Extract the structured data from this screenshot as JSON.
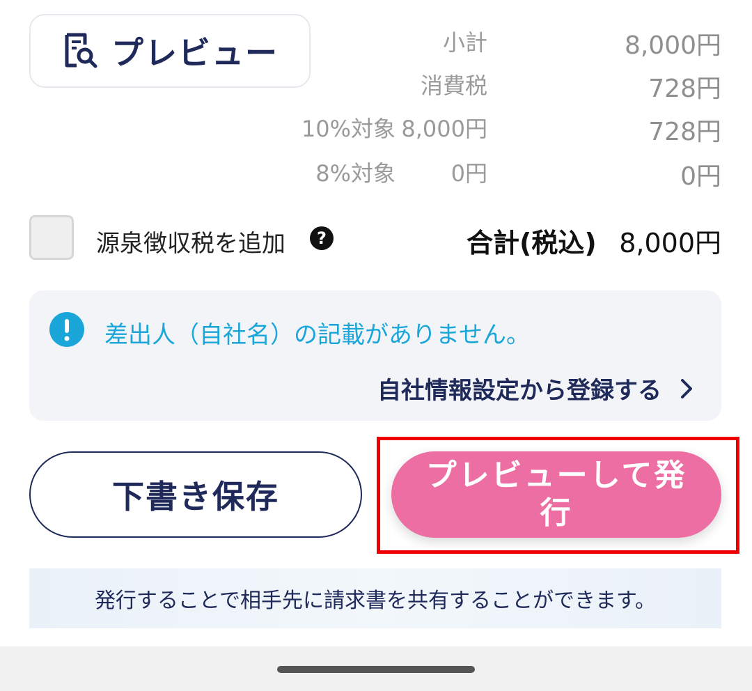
{
  "preview_button": {
    "label": "プレビュー",
    "icon": "document-search-icon"
  },
  "summary": {
    "subtotal": {
      "label": "小計",
      "value": "8,000円"
    },
    "tax": {
      "label": "消費税",
      "value": "728円"
    },
    "rate10": {
      "label": "10%対象",
      "base": "8,000円",
      "value": "728円"
    },
    "rate8": {
      "label": "8%対象",
      "base": "0円",
      "value": "0円"
    }
  },
  "withholding": {
    "label": "源泉徴収税を追加",
    "help_icon": "question-circle-icon",
    "checked": false
  },
  "total": {
    "label": "合計(税込)",
    "value": "8,000円"
  },
  "notice": {
    "icon": "exclamation-circle-icon",
    "message": "差出人（自社名）の記載がありません。",
    "link_label": "自社情報設定から登録する",
    "link_icon": "chevron-right-icon"
  },
  "actions": {
    "draft_label": "下書き保存",
    "issue_label": "プレビューして発行"
  },
  "share_note": "発行することで相手先に請求書を共有することができます。",
  "colors": {
    "navy": "#1f2a5a",
    "pink": "#ec6ea3",
    "info_blue": "#1ba6d9",
    "highlight_red": "#ee0000"
  }
}
